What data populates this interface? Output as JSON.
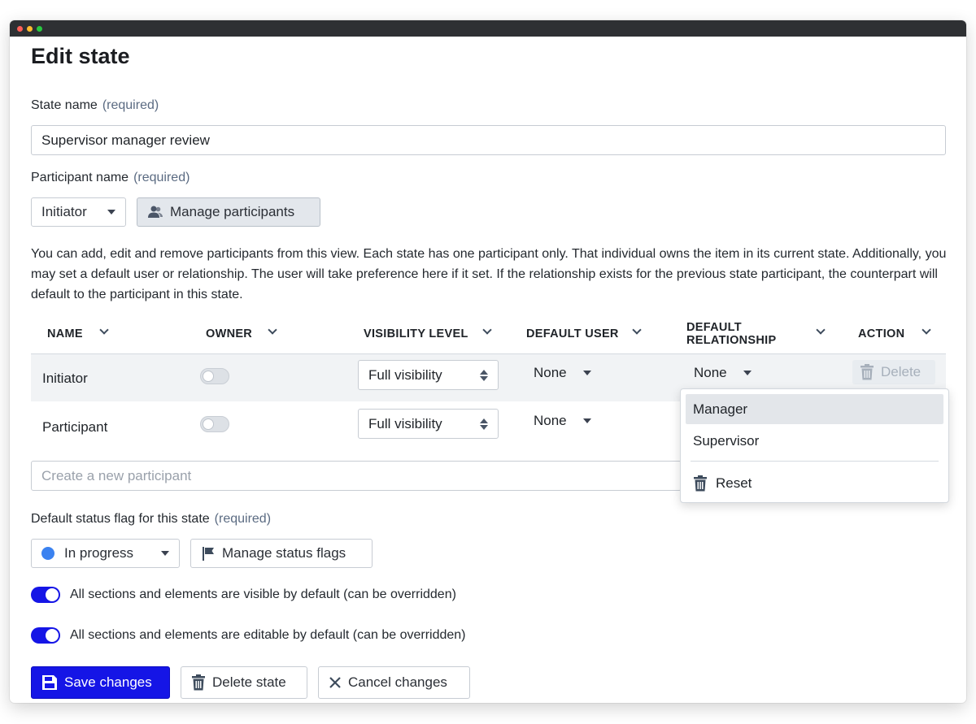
{
  "window": {
    "title_dots": [
      "red",
      "yellow",
      "green"
    ]
  },
  "page": {
    "title": "Edit state"
  },
  "state_name": {
    "label": "State name",
    "required": "(required)",
    "value": "Supervisor manager review"
  },
  "participant": {
    "label": "Participant name",
    "required": "(required)",
    "selected": "Initiator",
    "manage_label": "Manage participants"
  },
  "description": "You can add, edit and remove participants from this view. Each state has one participant only. That individual owns the item in its current state. Additionally, you may set a default user or relationship. The user will take preference here if it set. If the relationship exists for the previous state participant, the counterpart will default to the participant in this state.",
  "table": {
    "headers": {
      "name": "NAME",
      "owner": "OWNER",
      "visibility": "VISIBILITY LEVEL",
      "default_user": "DEFAULT USER",
      "default_relationship_1": "DEFAULT",
      "default_relationship_2": "RELATIONSHIP",
      "action": "ACTION"
    },
    "rows": [
      {
        "name": "Initiator",
        "owner": false,
        "visibility": "Full visibility",
        "default_user": "None",
        "default_relationship": "None",
        "action": "Delete"
      },
      {
        "name": "Participant",
        "owner": false,
        "visibility": "Full visibility",
        "default_user": "None"
      }
    ],
    "new_participant_placeholder": "Create a new participant"
  },
  "relationship_dropdown": {
    "options": [
      "Manager",
      "Supervisor"
    ],
    "highlighted": "Manager",
    "reset_label": "Reset"
  },
  "status_flag": {
    "label": "Default status flag for this state",
    "required": "(required)",
    "selected": "In progress",
    "selected_color": "#3b82f0",
    "manage_label": "Manage status flags"
  },
  "toggles": {
    "visible_label": "All sections and elements are visible by default (can be overridden)",
    "visible_on": true,
    "editable_label": "All sections and elements are editable by default (can be overridden)",
    "editable_on": true
  },
  "actions": {
    "save": "Save changes",
    "delete": "Delete state",
    "cancel": "Cancel changes"
  },
  "colors": {
    "primary": "#1515e6",
    "accent_blue": "#3b82f0"
  }
}
